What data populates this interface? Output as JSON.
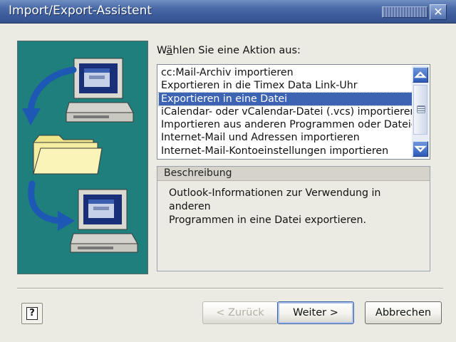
{
  "window": {
    "title": "Import/Export-Assistent",
    "close_glyph": "✕"
  },
  "colors": {
    "titlebar": "#3b5a9a",
    "art_background": "#1f7f7c",
    "selection": "#3d63b3",
    "arrow": "#1d58b5",
    "folder": "#f5eea0"
  },
  "icons": {
    "close": "close-icon",
    "help": "help-icon",
    "scroll_up": "scroll-up-icon",
    "scroll_down": "scroll-down-icon",
    "upper_computer": "computer-icon",
    "folder": "folder-icon",
    "lower_computer": "computer-icon",
    "arrows": "arrow-icon"
  },
  "action": {
    "label_pre": "W",
    "label_mnemonic": "ä",
    "label_post": "hlen Sie eine Aktion aus:",
    "options": [
      "cc:Mail-Archiv importieren",
      "Exportieren in die Timex Data Link-Uhr",
      "Exportieren in eine Datei",
      "iCalendar- oder vCalendar-Datei (.vcs) importieren",
      "Importieren aus anderen Programmen oder Dateien",
      "Internet-Mail und Adressen importieren",
      "Internet-Mail-Kontoeinstellungen importieren"
    ],
    "selected_index": 2
  },
  "description": {
    "title": "Beschreibung",
    "line1": "Outlook-Informationen zur Verwendung in anderen",
    "line2": "Programmen in eine Datei exportieren."
  },
  "buttons": {
    "help": "?",
    "back": "< Zurück",
    "next": "Weiter >",
    "cancel": "Abbrechen"
  }
}
